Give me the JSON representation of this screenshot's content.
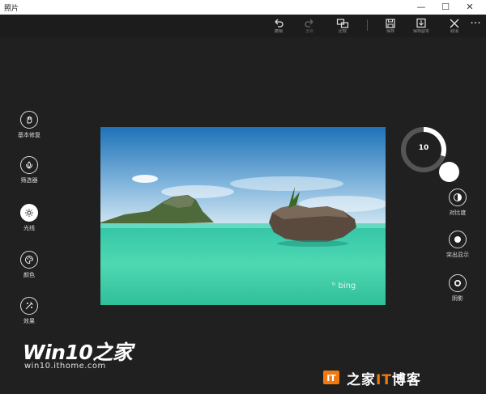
{
  "window": {
    "title": "照片",
    "minimize": "—",
    "maximize": "☐",
    "close": "✕"
  },
  "toolbar": {
    "undo": {
      "label": "撤销",
      "icon": "undo-icon"
    },
    "redo": {
      "label": "重做",
      "icon": "redo-icon"
    },
    "compare": {
      "label": "比较",
      "icon": "compare-icon"
    },
    "save": {
      "label": "保存",
      "icon": "save-icon"
    },
    "save_copy": {
      "label": "保存副本",
      "icon": "save-copy-icon"
    },
    "cancel": {
      "label": "取消",
      "icon": "close-icon"
    },
    "more": "···"
  },
  "tools": [
    {
      "label": "基本修复",
      "icon": "hand-icon",
      "active": false
    },
    {
      "label": "筛选器",
      "icon": "filter-icon",
      "active": false
    },
    {
      "label": "光线",
      "icon": "sun-icon",
      "active": true
    },
    {
      "label": "颜色",
      "icon": "palette-icon",
      "active": false
    },
    {
      "label": "效果",
      "icon": "effects-icon",
      "active": false
    }
  ],
  "photo": {
    "watermark": "bing"
  },
  "dial": {
    "value": "10",
    "fraction": 0.3
  },
  "adjustments": [
    {
      "label": "对比度",
      "icon": "contrast-icon"
    },
    {
      "label": "突出显示",
      "icon": "highlight-icon"
    },
    {
      "label": "阴影",
      "icon": "shadow-icon"
    }
  ],
  "watermarks": {
    "brand": "Win10之家",
    "url": "win10.ithome.com",
    "site_prefix": "IT",
    "site_name_a": "之家",
    "site_it": "IT",
    "site_name_b": "博客"
  },
  "colors": {
    "background": "#202020",
    "accent_white": "#ffffff",
    "logo_orange": "#f07a10"
  }
}
